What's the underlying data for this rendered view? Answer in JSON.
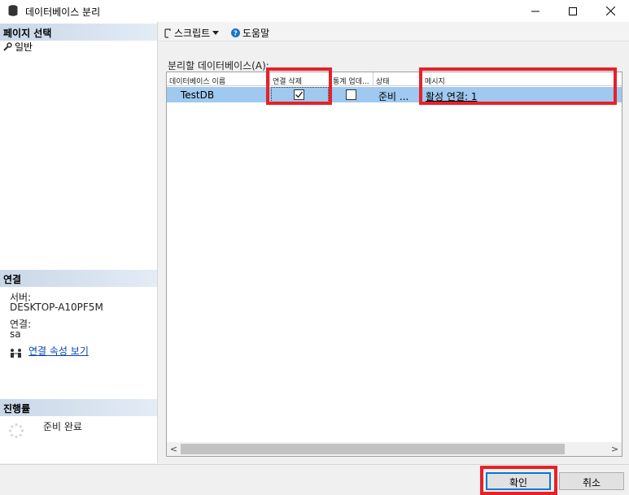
{
  "window": {
    "title": "데이터베이스 분리",
    "min_symbol": "—",
    "max_symbol": "☐",
    "close_symbol": "✕"
  },
  "left": {
    "select_page_header": "페이지 선택",
    "nav_items": [
      {
        "label": "일반",
        "icon": "wrench-icon"
      }
    ],
    "connection_header": "연결",
    "server_label": "서버:",
    "server_value": "DESKTOP-A10PF5M",
    "connection_label": "연결:",
    "connection_value": "sa",
    "view_properties_link": "연결 속성 보기",
    "progress_header": "진행률",
    "progress_status": "준비 완료"
  },
  "toolbar": {
    "script_label": "스크립트",
    "help_label": "도움말"
  },
  "grid": {
    "label": "분리할 데이터베이스(A):",
    "columns": [
      "데이터베이스 이름",
      "연결 삭제",
      "통계 업데...",
      "상태",
      "메시지"
    ],
    "rows": [
      {
        "name": "TestDB",
        "drop_connections": true,
        "update_stats": false,
        "status": "준비 ...",
        "message": "활성 연결: 1"
      }
    ],
    "left_arrow": "<",
    "right_arrow": ">"
  },
  "footer": {
    "ok_label": "확인",
    "cancel_label": "취소"
  },
  "colors": {
    "selection": "#9fc9ef",
    "highlight": "#e6212a",
    "header_gradient": "#c9d7e8"
  }
}
